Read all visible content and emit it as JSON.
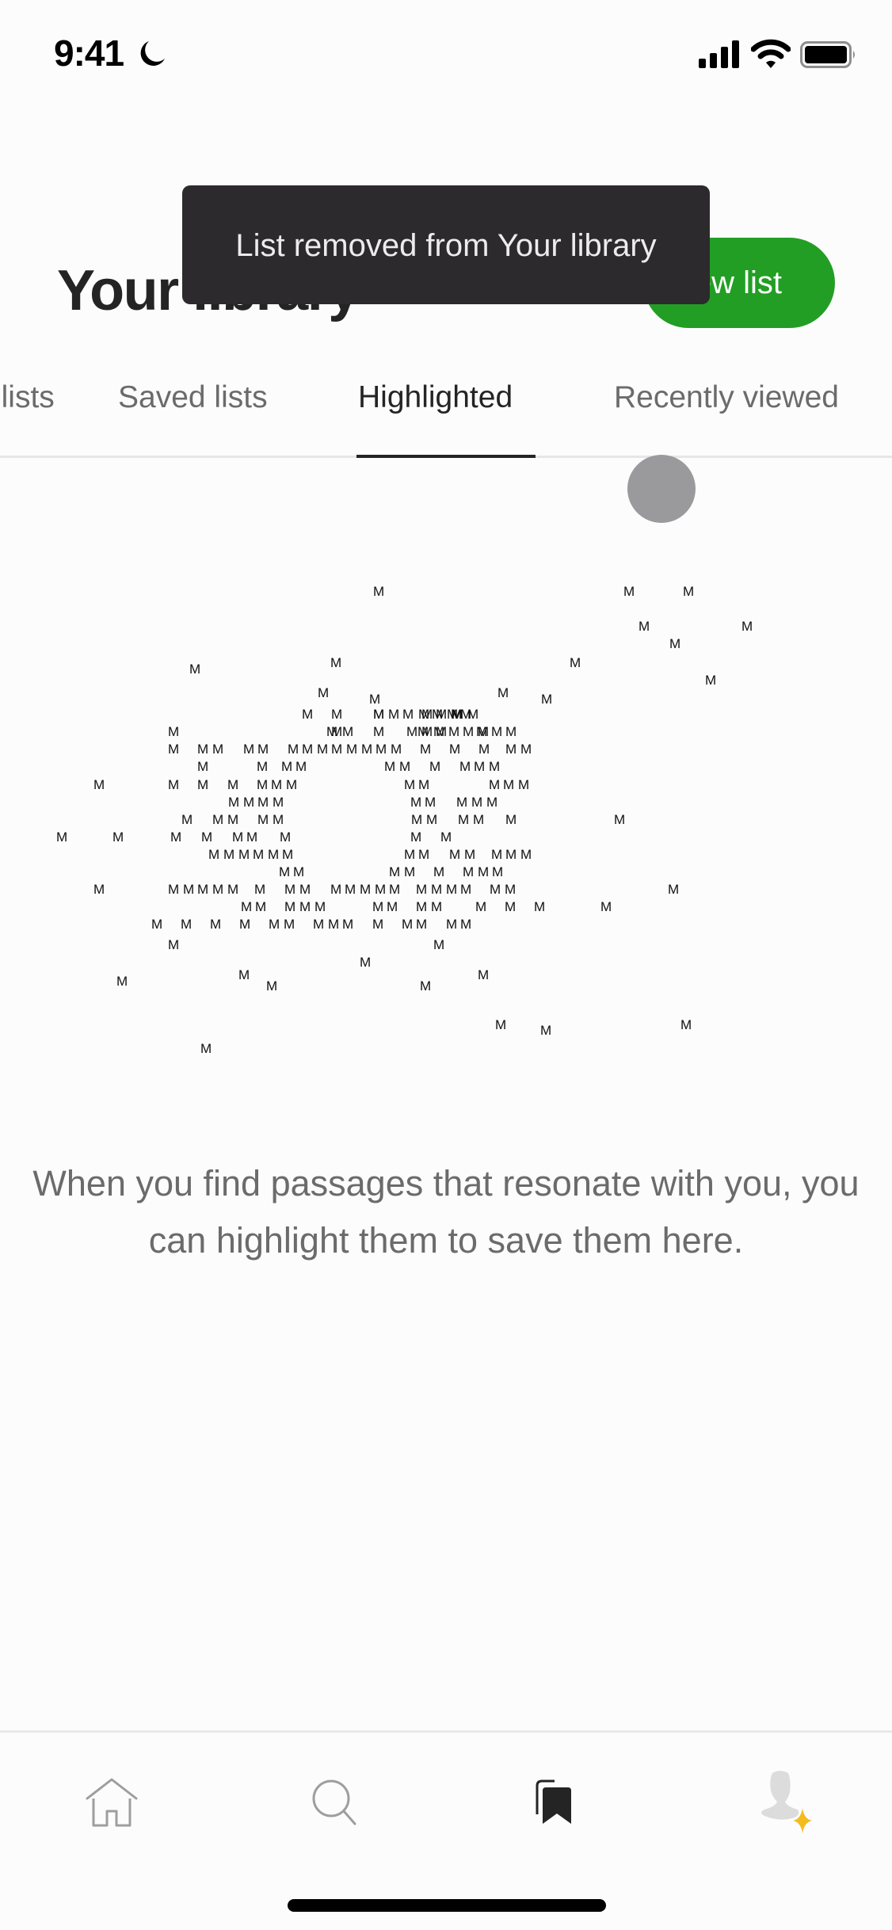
{
  "status_bar": {
    "time": "9:41",
    "focus_icon": "moon-icon",
    "signal_icon": "cellular-signal-icon",
    "wifi_icon": "wifi-icon",
    "battery_icon": "battery-icon"
  },
  "header": {
    "title": "Your library",
    "new_list_label": "New list"
  },
  "toast": {
    "message": "List removed from Your library"
  },
  "tabs": [
    {
      "label": "Your lists",
      "active": false
    },
    {
      "label": "Saved lists",
      "active": false
    },
    {
      "label": "Highlighted",
      "active": true
    },
    {
      "label": "Recently viewed",
      "active": false
    }
  ],
  "illustration": {
    "glyph": "M"
  },
  "empty_state": {
    "message": "When you find passages that resonate with you, you can highlight them to save them here."
  },
  "bottom_nav": [
    {
      "name": "home",
      "icon": "home-icon",
      "active": false
    },
    {
      "name": "search",
      "icon": "search-icon",
      "active": false
    },
    {
      "name": "library",
      "icon": "bookmarks-icon",
      "active": true
    },
    {
      "name": "profile",
      "icon": "profile-avatar-icon",
      "active": false
    }
  ],
  "colors": {
    "accent_green": "#229e24",
    "toast_bg": "#2c2a2d",
    "text_primary": "#242424",
    "text_secondary": "#6b6b6b",
    "star_gold": "#f5bb1c"
  }
}
